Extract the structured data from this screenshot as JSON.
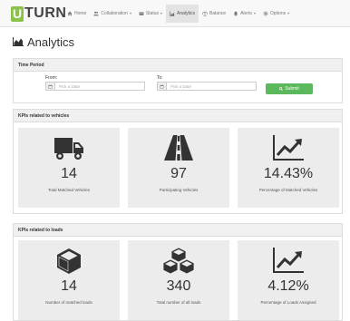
{
  "brand": {
    "letter": "U",
    "rest": "TURN",
    "accent": "#8bc34a"
  },
  "nav": [
    {
      "label": "Home",
      "icon": "home-icon",
      "caret": false,
      "active": false
    },
    {
      "label": "Collaboration",
      "icon": "users-icon",
      "caret": true,
      "active": false
    },
    {
      "label": "Status",
      "icon": "status-icon",
      "caret": true,
      "active": false
    },
    {
      "label": "Analytics",
      "icon": "chart-icon",
      "caret": false,
      "active": true
    },
    {
      "label": "Balance",
      "icon": "balance-icon",
      "caret": false,
      "active": false
    },
    {
      "label": "Alerts",
      "icon": "bell-icon",
      "caret": true,
      "active": false
    },
    {
      "label": "Options",
      "icon": "gear-icon",
      "caret": true,
      "active": false
    }
  ],
  "page": {
    "title": "Analytics",
    "title_icon": "area-chart-icon"
  },
  "time_period": {
    "heading": "Time Period",
    "from_label": "From:",
    "from_placeholder": "Pick a Date",
    "to_label": "To:",
    "to_placeholder": "Pick a Date",
    "submit_label": "Submit",
    "submit_color": "#5cb85c"
  },
  "kpi_vehicles": {
    "heading": "KPIs related to vehicles",
    "tiles": [
      {
        "icon": "truck-icon",
        "value": "14",
        "label": "Total Matched Vehicles"
      },
      {
        "icon": "road-icon",
        "value": "97",
        "label": "Participating Vehicles"
      },
      {
        "icon": "line-chart-icon",
        "value": "14.43%",
        "label": "Percentage of Matched Vehicles"
      }
    ]
  },
  "kpi_loads": {
    "heading": "KPIs related to loads",
    "tiles": [
      {
        "icon": "cube-icon",
        "value": "14",
        "label": "Number of matched loads"
      },
      {
        "icon": "cubes-icon",
        "value": "340",
        "label": "Total number of all loads"
      },
      {
        "icon": "line-chart-icon",
        "value": "4.12%",
        "label": "Percentage of Loads Assigned"
      }
    ]
  }
}
